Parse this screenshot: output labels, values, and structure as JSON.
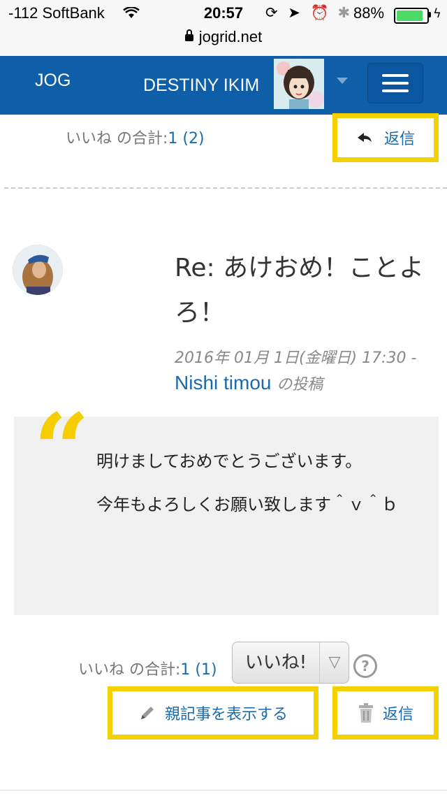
{
  "status_bar": {
    "carrier": "-112 SoftBank",
    "time": "20:57",
    "battery_percent": "88%",
    "battery_level": 0.88,
    "url": "jogrid.net"
  },
  "navbar": {
    "brand": "JOG",
    "username": "DESTINY IKIM",
    "color": "#0e5fa8"
  },
  "previous_post": {
    "likes_label": "いいね の合計:",
    "likes_value": "1 (2)",
    "reply_label": "返信"
  },
  "post": {
    "title": "Re: あけおめ！ことよろ！",
    "date": "2016年 01月 1日(金曜日) 17:30 -",
    "author": "Nishi timou",
    "author_suffix": "の投稿",
    "body": [
      "明けましておめでとうございます。",
      "今年もよろしくお願い致します＾ｖ＾ｂ"
    ],
    "likes_label": "いいね の合計:",
    "likes_value": "1 (1)",
    "like_select": "いいね!",
    "help": "?",
    "parent_button": "親記事を表示する",
    "reply_button": "返信"
  },
  "colors": {
    "highlight": "#f5d000",
    "link": "#1b6aad",
    "quote": "#f5cd00"
  }
}
